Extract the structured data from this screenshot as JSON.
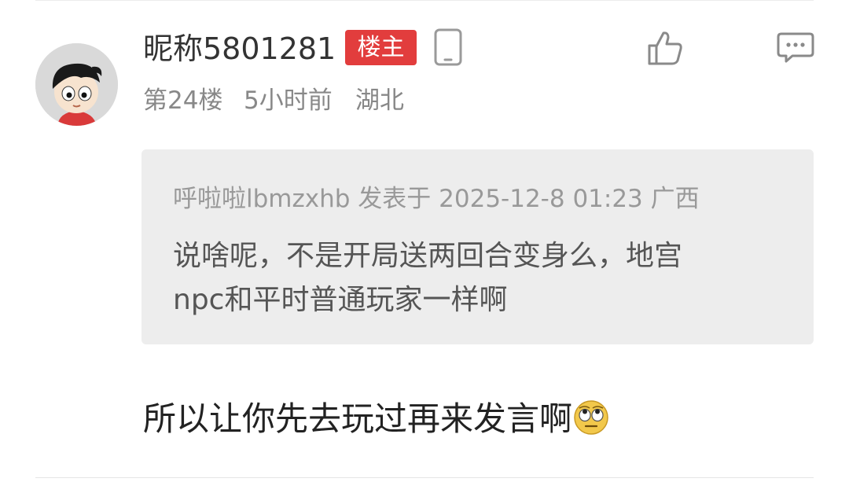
{
  "post": {
    "username": "昵称5801281",
    "op_badge": "楼主",
    "floor": "第24楼",
    "time": "5小时前",
    "location": "湖北",
    "quote": {
      "author": "呼啦啦lbmzxhb",
      "posted_at_label": "发表于",
      "date": "2025-12-8 01:23",
      "location": "广西",
      "text_line1": "说啥呢，不是开局送两回合变身么，地宫",
      "text_line2": "npc和平时普通玩家一样啊"
    },
    "comment": "所以让你先去玩过再来发言啊"
  },
  "icons": {
    "device": "phone-icon",
    "like": "thumbs-up-icon",
    "reply": "comment-bubble-icon",
    "emoji": "eye-roll-emoji"
  },
  "colors": {
    "op_badge": "#e23d3d",
    "quote_bg": "#ededed",
    "meta_text": "#888888"
  }
}
